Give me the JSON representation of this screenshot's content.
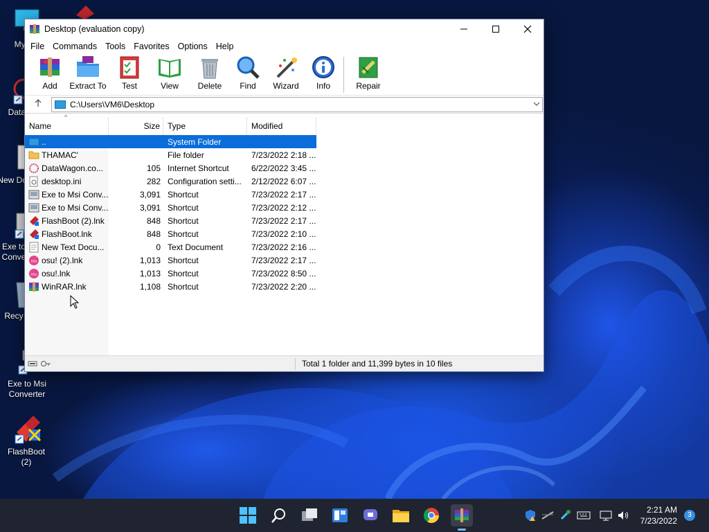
{
  "desktop": {
    "icons": [
      {
        "label": "My Co",
        "icon": "computer-icon"
      },
      {
        "label": "DataW",
        "icon": "datawagon-icon"
      },
      {
        "label": "New Docu",
        "icon": "text-doc-icon"
      },
      {
        "label": "Exe to Conve",
        "icon": "exe-to-msi-icon"
      },
      {
        "label": "Recy",
        "icon": "recycle-bin-icon"
      },
      {
        "label": "Exe to Msi Converter",
        "icon": "exe-to-msi-icon"
      },
      {
        "label": "FlashBoot (2)",
        "icon": "flashboot-icon"
      }
    ]
  },
  "window": {
    "title": "Desktop (evaluation copy)",
    "menu": [
      "File",
      "Commands",
      "Tools",
      "Favorites",
      "Options",
      "Help"
    ],
    "toolbar": [
      {
        "label": "Add",
        "icon": "add-archive-icon"
      },
      {
        "label": "Extract To",
        "icon": "extract-folder-icon"
      },
      {
        "label": "Test",
        "icon": "test-clipboard-icon"
      },
      {
        "label": "View",
        "icon": "view-book-icon"
      },
      {
        "label": "Delete",
        "icon": "trash-icon"
      },
      {
        "label": "Find",
        "icon": "magnifier-icon"
      },
      {
        "label": "Wizard",
        "icon": "wand-icon"
      },
      {
        "label": "Info",
        "icon": "info-icon"
      },
      {
        "label": "Repair",
        "icon": "repair-icon"
      }
    ],
    "address": {
      "path": "C:\\Users\\VM6\\Desktop"
    },
    "columns": {
      "name": "Name",
      "size": "Size",
      "type": "Type",
      "modified": "Modified"
    },
    "files": [
      {
        "name": "..",
        "size": "",
        "type": "System Folder",
        "modified": "",
        "icon": "system-folder-icon",
        "selected": true
      },
      {
        "name": "THAMAC'",
        "size": "",
        "type": "File folder",
        "modified": "7/23/2022 2:18 ...",
        "icon": "folder-icon"
      },
      {
        "name": "DataWagon.co...",
        "size": "105",
        "type": "Internet Shortcut",
        "modified": "6/22/2022 3:45 ...",
        "icon": "internet-shortcut-icon"
      },
      {
        "name": "desktop.ini",
        "size": "282",
        "type": "Configuration setti...",
        "modified": "2/12/2022 6:07 ...",
        "icon": "config-file-icon"
      },
      {
        "name": "Exe to Msi Conv...",
        "size": "3,091",
        "type": "Shortcut",
        "modified": "7/23/2022 2:17 ...",
        "icon": "exe-to-msi-icon"
      },
      {
        "name": "Exe to Msi Conv...",
        "size": "3,091",
        "type": "Shortcut",
        "modified": "7/23/2022 2:12 ...",
        "icon": "exe-to-msi-icon"
      },
      {
        "name": "FlashBoot (2).lnk",
        "size": "848",
        "type": "Shortcut",
        "modified": "7/23/2022 2:17 ...",
        "icon": "flashboot-icon"
      },
      {
        "name": "FlashBoot.lnk",
        "size": "848",
        "type": "Shortcut",
        "modified": "7/23/2022 2:10 ...",
        "icon": "flashboot-icon"
      },
      {
        "name": "New Text Docu...",
        "size": "0",
        "type": "Text Document",
        "modified": "7/23/2022 2:16 ...",
        "icon": "text-doc-icon"
      },
      {
        "name": "osu! (2).lnk",
        "size": "1,013",
        "type": "Shortcut",
        "modified": "7/23/2022 2:17 ...",
        "icon": "osu-icon"
      },
      {
        "name": "osu!.lnk",
        "size": "1,013",
        "type": "Shortcut",
        "modified": "7/23/2022 8:50 ...",
        "icon": "osu-icon"
      },
      {
        "name": "WinRAR.lnk",
        "size": "1,108",
        "type": "Shortcut",
        "modified": "7/23/2022 2:20 ...",
        "icon": "winrar-icon"
      }
    ],
    "status": {
      "text": "Total 1 folder and 11,399 bytes in 10 files"
    }
  },
  "taskbar": {
    "apps": [
      "start-icon",
      "search-icon",
      "task-view-icon",
      "widgets-icon",
      "chat-icon",
      "file-explorer-icon",
      "chrome-icon",
      "winrar-icon"
    ],
    "active_app": "winrar-icon",
    "clock": {
      "time": "2:21 AM",
      "date": "7/23/2022"
    },
    "notifications": "3"
  },
  "colors": {
    "selection": "#0a6dd9",
    "taskbar": "#1f2430",
    "accent": "#76b9ed"
  }
}
